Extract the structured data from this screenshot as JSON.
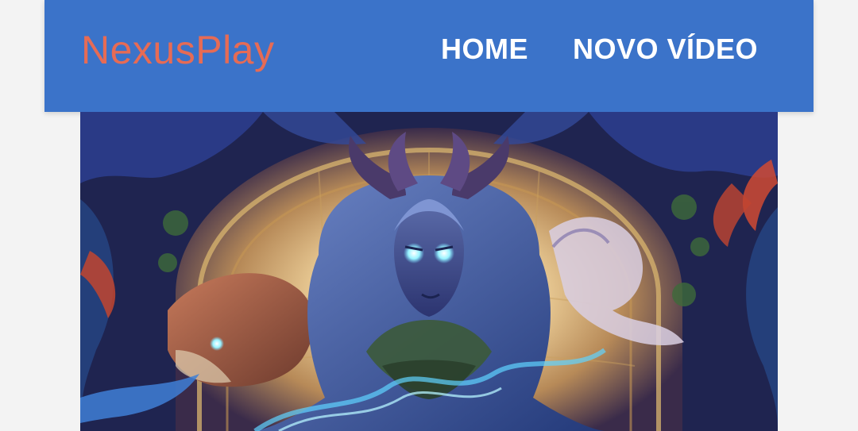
{
  "header": {
    "brand": "NexusPlay",
    "nav": [
      {
        "label": "HOME"
      },
      {
        "label": "NOVO VÍDEO"
      }
    ]
  },
  "colors": {
    "header_bg": "#3b73c9",
    "brand": "#e66b55",
    "nav_text": "#ffffff",
    "page_bg": "#f3f3f3"
  },
  "banner": {
    "subject": "fantasy-character-artwork"
  }
}
